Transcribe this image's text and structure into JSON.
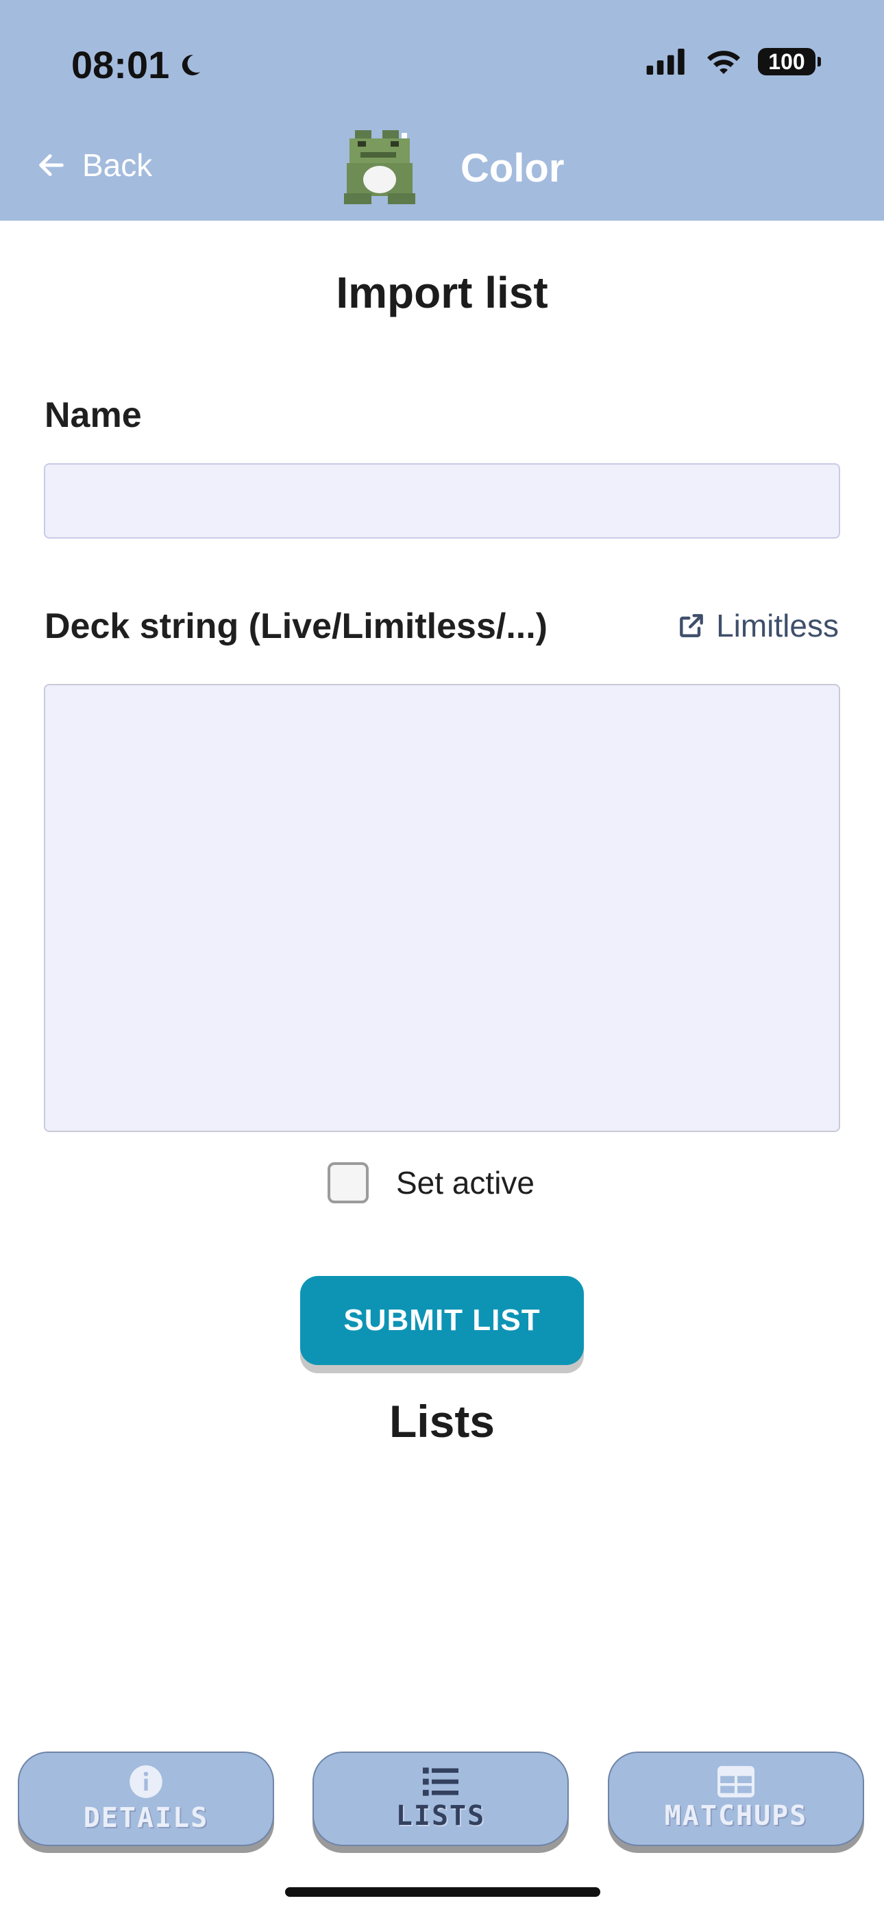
{
  "status_bar": {
    "time": "08:01",
    "battery": "100"
  },
  "header": {
    "back_label": "Back",
    "title": "Color"
  },
  "page": {
    "heading": "Import list",
    "name_label": "Name",
    "name_value": "",
    "deck_label": "Deck string (Live/Limitless/...)",
    "limitless_link": "Limitless",
    "deck_value": "",
    "set_active_label": "Set active",
    "set_active_checked": false,
    "submit_label": "SUBMIT LIST",
    "lists_heading": "Lists"
  },
  "tabs": [
    {
      "label": "DETAILS",
      "icon": "info-icon",
      "active": false
    },
    {
      "label": "LISTS",
      "icon": "list-icon",
      "active": true
    },
    {
      "label": "MATCHUPS",
      "icon": "grid-icon",
      "active": false
    }
  ],
  "colors": {
    "header_bg": "#a3bbdd",
    "accent_button": "#0d94b5",
    "input_bg": "#eff0fb"
  }
}
